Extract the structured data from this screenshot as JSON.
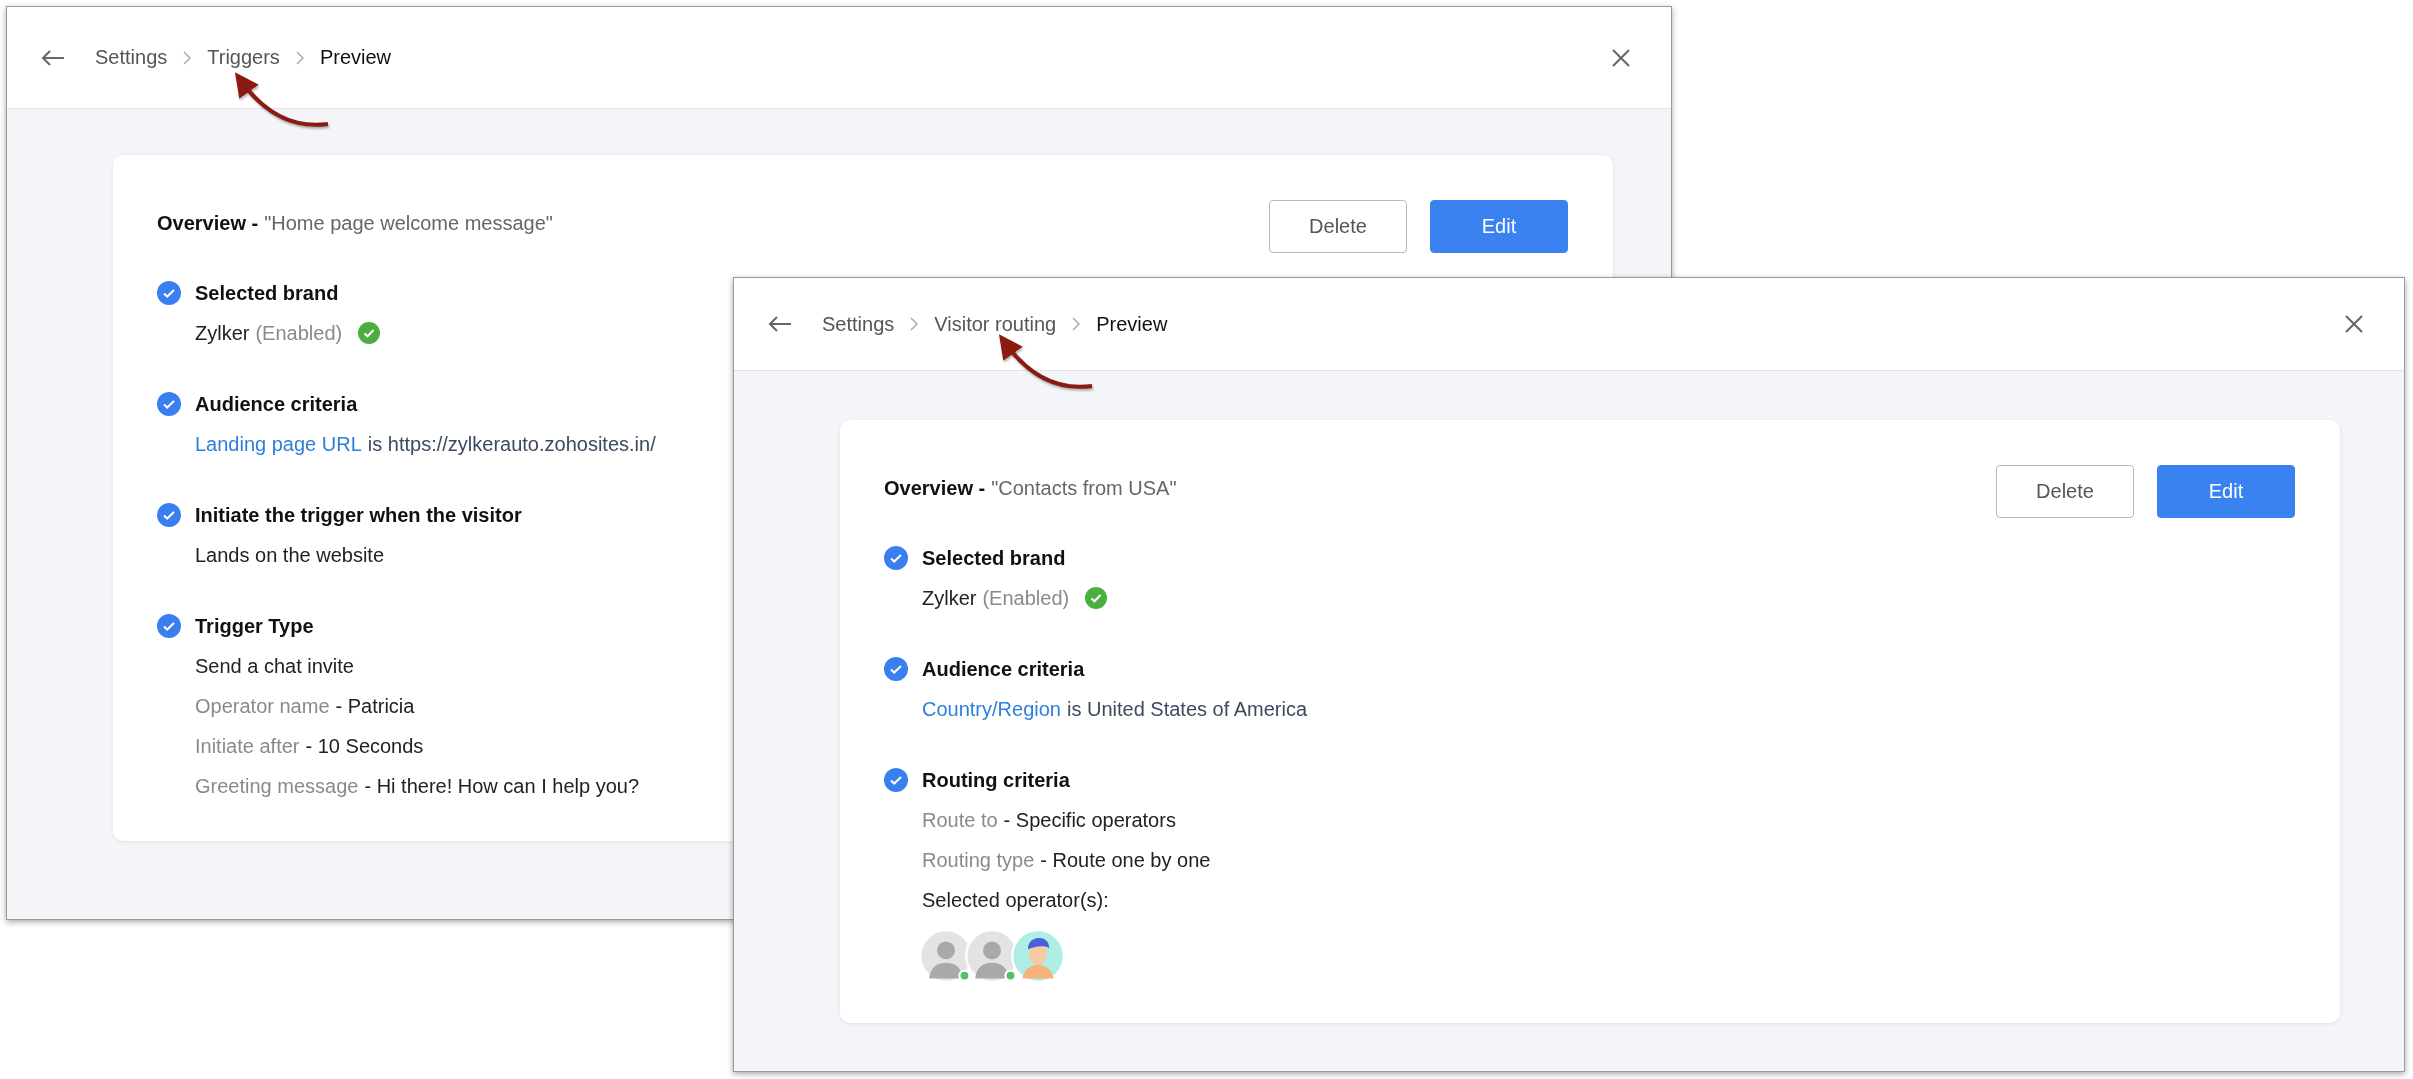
{
  "windows": [
    {
      "breadcrumb": [
        {
          "label": "Settings",
          "current": false
        },
        {
          "label": "Triggers",
          "current": false
        },
        {
          "label": "Preview",
          "current": true
        }
      ],
      "overview": {
        "title": "Overview -",
        "name": "\"Home page welcome message\""
      },
      "buttons": [
        {
          "label": "Delete",
          "kind": "secondary"
        },
        {
          "label": "Edit",
          "kind": "primary"
        }
      ],
      "sections": [
        {
          "heading": "Selected brand",
          "checked": true,
          "lines": [
            {
              "kind": "brand",
              "name": "Zylker",
              "status": "(Enabled)",
              "enabled": true
            }
          ]
        },
        {
          "heading": "Audience criteria",
          "checked": true,
          "lines": [
            {
              "kind": "criteria",
              "field": "Landing page URL",
              "rest": "is https://zylkerauto.zohosites.in/"
            }
          ]
        },
        {
          "heading": "Initiate the trigger when the visitor",
          "checked": true,
          "lines": [
            {
              "kind": "plain",
              "text": "Lands on the website"
            }
          ]
        },
        {
          "heading": "Trigger Type",
          "checked": true,
          "lines": [
            {
              "kind": "plain",
              "text": "Send a chat invite"
            },
            {
              "kind": "pair",
              "label": "Operator name",
              "value": "- Patricia"
            },
            {
              "kind": "pair",
              "label": "Initiate after",
              "value": "- 10 Seconds"
            },
            {
              "kind": "pair",
              "label": "Greeting message",
              "value": "- Hi there! How can I help you?"
            }
          ]
        }
      ]
    },
    {
      "breadcrumb": [
        {
          "label": "Settings",
          "current": false
        },
        {
          "label": "Visitor routing",
          "current": false
        },
        {
          "label": "Preview",
          "current": true
        }
      ],
      "overview": {
        "title": "Overview -",
        "name": "\"Contacts from USA\""
      },
      "buttons": [
        {
          "label": "Delete",
          "kind": "secondary"
        },
        {
          "label": "Edit",
          "kind": "primary"
        }
      ],
      "sections": [
        {
          "heading": "Selected brand",
          "checked": true,
          "lines": [
            {
              "kind": "brand",
              "name": "Zylker",
              "status": "(Enabled)",
              "enabled": true
            }
          ]
        },
        {
          "heading": "Audience criteria",
          "checked": true,
          "lines": [
            {
              "kind": "criteria",
              "field": "Country/Region",
              "rest": "is United States of America"
            }
          ]
        },
        {
          "heading": "Routing criteria",
          "checked": true,
          "lines": [
            {
              "kind": "pair",
              "label": "Route to",
              "value": "- Specific operators"
            },
            {
              "kind": "pair",
              "label": "Routing type",
              "value": "- Route one by one"
            },
            {
              "kind": "plain",
              "text": "Selected operator(s):"
            },
            {
              "kind": "avatars",
              "operators": [
                {
                  "kind": "silhouette",
                  "online": true
                },
                {
                  "kind": "silhouette",
                  "online": true
                },
                {
                  "kind": "illustration",
                  "online": false
                }
              ]
            }
          ]
        }
      ]
    }
  ]
}
